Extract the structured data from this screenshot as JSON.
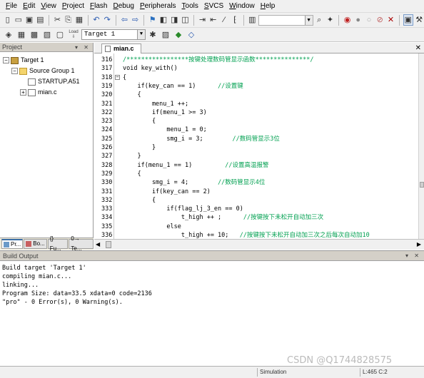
{
  "menu": [
    {
      "label": "File",
      "ul": "F",
      "rest": "ile"
    },
    {
      "label": "Edit",
      "ul": "E",
      "rest": "dit"
    },
    {
      "label": "View",
      "ul": "V",
      "rest": "iew"
    },
    {
      "label": "Project",
      "ul": "P",
      "rest": "roject"
    },
    {
      "label": "Flash",
      "ul": "F",
      "rest": "lash"
    },
    {
      "label": "Debug",
      "ul": "D",
      "rest": "ebug"
    },
    {
      "label": "Peripherals",
      "ul": "P",
      "rest": "eripherals"
    },
    {
      "label": "Tools",
      "ul": "T",
      "rest": "ools"
    },
    {
      "label": "SVCS",
      "ul": "S",
      "rest": "VCS"
    },
    {
      "label": "Window",
      "ul": "W",
      "rest": "indow"
    },
    {
      "label": "Help",
      "ul": "H",
      "rest": "elp"
    }
  ],
  "toolbar": {
    "load_label": "Load",
    "target_value": "Target 1"
  },
  "project_panel": {
    "title": "Project",
    "tree": {
      "target": "Target 1",
      "group": "Source Group 1",
      "files": [
        "STARTUP.A51",
        "mian.c"
      ]
    },
    "tabs": [
      "Pr...",
      "Bo...",
      "{} Fu...",
      "0→ Te..."
    ]
  },
  "editor": {
    "tab_label": "mian.c",
    "lines": [
      {
        "n": "316",
        "code": "/*****************按键处理数码管显示函数***************/",
        "comment": true
      },
      {
        "n": "317",
        "code": "void key_with()"
      },
      {
        "n": "318",
        "code": "{",
        "fold": true
      },
      {
        "n": "319",
        "code": "    if(key_can == 1)",
        "tail": "      //设置键"
      },
      {
        "n": "320",
        "code": "    {"
      },
      {
        "n": "321",
        "code": "        menu_1 ++;"
      },
      {
        "n": "322",
        "code": "        if(menu_1 >= 3)"
      },
      {
        "n": "323",
        "code": "        {"
      },
      {
        "n": "324",
        "code": "            menu_1 = 0;"
      },
      {
        "n": "325",
        "code": "            smg_i = 3;",
        "tail": "        //数码管显示3位"
      },
      {
        "n": "326",
        "code": "        }"
      },
      {
        "n": "327",
        "code": "    }"
      },
      {
        "n": "328",
        "code": "    if(menu_1 == 1)",
        "tail": "         //设置高温报警"
      },
      {
        "n": "329",
        "code": "    {"
      },
      {
        "n": "330",
        "code": "        smg_i = 4;",
        "tail": "        //数码管显示4位"
      },
      {
        "n": "331",
        "code": "        if(key_can == 2)"
      },
      {
        "n": "332",
        "code": "        {"
      },
      {
        "n": "333",
        "code": "            if(flag_lj_3_en == 0)"
      },
      {
        "n": "334",
        "code": "                t_high ++ ;",
        "tail": "      //按键按下未松开自动加三次"
      },
      {
        "n": "335",
        "code": "            else"
      },
      {
        "n": "336",
        "code": "                t_high += 10;",
        "tail": "   //按键按下未松开自动加三次之后每次自动加10"
      }
    ]
  },
  "build_output": {
    "title": "Build Output",
    "lines": [
      "Build target 'Target 1'",
      "compiling mian.c...",
      "linking...",
      "Program Size: data=33.5 xdata=0 code=2136",
      "\"pro\" - 0 Error(s), 0 Warning(s)."
    ]
  },
  "status": {
    "mode": "Simulation",
    "position": "L:465 C:2",
    "watermark": "CSDN @Q1744828575"
  }
}
